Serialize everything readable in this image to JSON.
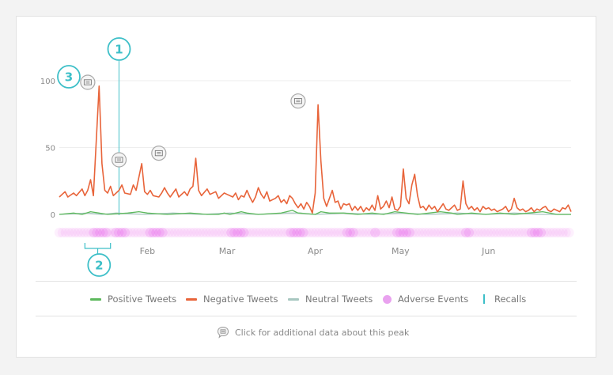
{
  "colors": {
    "positive": "#5cb85c",
    "negative": "#e8643a",
    "neutral": "#a7c7c0",
    "adverse": "#e23be6",
    "recall": "#3dbfc8",
    "grid": "#eeeeee",
    "axis_text": "#8a8a8a"
  },
  "chart_data": {
    "type": "line",
    "xlabel": "",
    "ylabel": "",
    "x_range": [
      0,
      180
    ],
    "ylim": [
      0,
      100
    ],
    "yticks": [
      0,
      50,
      100
    ],
    "x_ticks": [
      {
        "label": "Feb",
        "x": 31
      },
      {
        "label": "Mar",
        "x": 59
      },
      {
        "label": "Apr",
        "x": 90
      },
      {
        "label": "May",
        "x": 120
      },
      {
        "label": "Jun",
        "x": 151
      }
    ],
    "series": [
      {
        "name": "Negative Tweets",
        "color_key": "negative",
        "points": [
          [
            0,
            13
          ],
          [
            2,
            17
          ],
          [
            3,
            13
          ],
          [
            5,
            16
          ],
          [
            6,
            14
          ],
          [
            8,
            19
          ],
          [
            9,
            14
          ],
          [
            10,
            18
          ],
          [
            11,
            26
          ],
          [
            12,
            14
          ],
          [
            14,
            96
          ],
          [
            15,
            38
          ],
          [
            16,
            18
          ],
          [
            17,
            16
          ],
          [
            18,
            21
          ],
          [
            19,
            14
          ],
          [
            21,
            18
          ],
          [
            22,
            22
          ],
          [
            23,
            16
          ],
          [
            25,
            15
          ],
          [
            26,
            22
          ],
          [
            27,
            18
          ],
          [
            29,
            38
          ],
          [
            30,
            17
          ],
          [
            31,
            15
          ],
          [
            32,
            18
          ],
          [
            33,
            14
          ],
          [
            35,
            13
          ],
          [
            36,
            16
          ],
          [
            37,
            20
          ],
          [
            38,
            16
          ],
          [
            39,
            13
          ],
          [
            41,
            19
          ],
          [
            42,
            13
          ],
          [
            44,
            17
          ],
          [
            45,
            14
          ],
          [
            46,
            19
          ],
          [
            47,
            21
          ],
          [
            48,
            42
          ],
          [
            49,
            18
          ],
          [
            50,
            14
          ],
          [
            52,
            19
          ],
          [
            53,
            15
          ],
          [
            55,
            17
          ],
          [
            56,
            12
          ],
          [
            58,
            16
          ],
          [
            59,
            15
          ],
          [
            61,
            13
          ],
          [
            62,
            16
          ],
          [
            63,
            11
          ],
          [
            64,
            14
          ],
          [
            65,
            13
          ],
          [
            66,
            18
          ],
          [
            67,
            13
          ],
          [
            68,
            9
          ],
          [
            69,
            13
          ],
          [
            70,
            20
          ],
          [
            71,
            15
          ],
          [
            72,
            12
          ],
          [
            73,
            17
          ],
          [
            74,
            10
          ],
          [
            76,
            12
          ],
          [
            77,
            14
          ],
          [
            78,
            9
          ],
          [
            79,
            11
          ],
          [
            80,
            8
          ],
          [
            81,
            14
          ],
          [
            82,
            12
          ],
          [
            83,
            8
          ],
          [
            84,
            5
          ],
          [
            85,
            8
          ],
          [
            86,
            4
          ],
          [
            87,
            9
          ],
          [
            88,
            6
          ],
          [
            89,
            1
          ],
          [
            90,
            16
          ],
          [
            91,
            82
          ],
          [
            92,
            40
          ],
          [
            93,
            12
          ],
          [
            94,
            6
          ],
          [
            95,
            12
          ],
          [
            96,
            18
          ],
          [
            97,
            9
          ],
          [
            98,
            10
          ],
          [
            99,
            4
          ],
          [
            100,
            8
          ],
          [
            101,
            7
          ],
          [
            102,
            8
          ],
          [
            103,
            3
          ],
          [
            104,
            6
          ],
          [
            105,
            3
          ],
          [
            106,
            6
          ],
          [
            107,
            2
          ],
          [
            108,
            5
          ],
          [
            109,
            3
          ],
          [
            110,
            7
          ],
          [
            111,
            3
          ],
          [
            112,
            14
          ],
          [
            113,
            4
          ],
          [
            114,
            6
          ],
          [
            115,
            10
          ],
          [
            116,
            5
          ],
          [
            117,
            13
          ],
          [
            118,
            4
          ],
          [
            119,
            3
          ],
          [
            120,
            6
          ],
          [
            121,
            34
          ],
          [
            122,
            12
          ],
          [
            123,
            8
          ],
          [
            124,
            22
          ],
          [
            125,
            30
          ],
          [
            126,
            14
          ],
          [
            127,
            5
          ],
          [
            128,
            6
          ],
          [
            129,
            3
          ],
          [
            130,
            7
          ],
          [
            131,
            4
          ],
          [
            132,
            6
          ],
          [
            133,
            2
          ],
          [
            134,
            5
          ],
          [
            135,
            8
          ],
          [
            136,
            4
          ],
          [
            137,
            3
          ],
          [
            138,
            5
          ],
          [
            139,
            7
          ],
          [
            140,
            3
          ],
          [
            141,
            4
          ],
          [
            142,
            25
          ],
          [
            143,
            8
          ],
          [
            144,
            4
          ],
          [
            145,
            6
          ],
          [
            146,
            3
          ],
          [
            147,
            5
          ],
          [
            148,
            2
          ],
          [
            149,
            6
          ],
          [
            150,
            4
          ],
          [
            151,
            5
          ],
          [
            152,
            3
          ],
          [
            153,
            4
          ],
          [
            154,
            2
          ],
          [
            155,
            3
          ],
          [
            156,
            4
          ],
          [
            157,
            6
          ],
          [
            158,
            2
          ],
          [
            159,
            4
          ],
          [
            160,
            12
          ],
          [
            161,
            5
          ],
          [
            162,
            3
          ],
          [
            163,
            4
          ],
          [
            164,
            2
          ],
          [
            165,
            3
          ],
          [
            166,
            5
          ],
          [
            167,
            2
          ],
          [
            168,
            4
          ],
          [
            169,
            3
          ],
          [
            170,
            5
          ],
          [
            171,
            6
          ],
          [
            172,
            3
          ],
          [
            173,
            2
          ],
          [
            174,
            4
          ],
          [
            175,
            3
          ],
          [
            176,
            2
          ],
          [
            177,
            5
          ],
          [
            178,
            4
          ],
          [
            179,
            7
          ],
          [
            180,
            2
          ]
        ]
      },
      {
        "name": "Positive Tweets",
        "color_key": "positive",
        "points": [
          [
            0,
            0
          ],
          [
            5,
            1
          ],
          [
            8,
            0
          ],
          [
            11,
            2
          ],
          [
            14,
            1
          ],
          [
            17,
            0
          ],
          [
            24,
            1
          ],
          [
            28,
            2
          ],
          [
            31,
            1
          ],
          [
            38,
            0
          ],
          [
            46,
            1
          ],
          [
            52,
            0
          ],
          [
            56,
            0
          ],
          [
            58,
            1
          ],
          [
            60,
            0
          ],
          [
            64,
            2
          ],
          [
            66,
            1
          ],
          [
            70,
            0
          ],
          [
            78,
            1
          ],
          [
            82,
            3
          ],
          [
            84,
            1
          ],
          [
            90,
            0
          ],
          [
            92,
            2
          ],
          [
            95,
            1
          ],
          [
            100,
            1
          ],
          [
            105,
            0
          ],
          [
            110,
            1
          ],
          [
            114,
            0
          ],
          [
            118,
            2
          ],
          [
            122,
            1
          ],
          [
            126,
            0
          ],
          [
            130,
            1
          ],
          [
            134,
            2
          ],
          [
            138,
            1
          ],
          [
            140,
            0
          ],
          [
            145,
            1
          ],
          [
            150,
            0
          ],
          [
            155,
            1
          ],
          [
            160,
            0
          ],
          [
            165,
            1
          ],
          [
            170,
            2
          ],
          [
            175,
            0
          ],
          [
            180,
            0
          ]
        ]
      },
      {
        "name": "Neutral Tweets",
        "color_key": "neutral",
        "points": [
          [
            0,
            0
          ],
          [
            10,
            1
          ],
          [
            15,
            0
          ],
          [
            20,
            1
          ],
          [
            30,
            0
          ],
          [
            40,
            1
          ],
          [
            50,
            0
          ],
          [
            60,
            1
          ],
          [
            70,
            0
          ],
          [
            80,
            1
          ],
          [
            85,
            1
          ],
          [
            90,
            0
          ],
          [
            100,
            1
          ],
          [
            110,
            0
          ],
          [
            120,
            1
          ],
          [
            130,
            0
          ],
          [
            140,
            1
          ],
          [
            150,
            0
          ],
          [
            160,
            1
          ],
          [
            170,
            0
          ],
          [
            180,
            0
          ]
        ]
      }
    ],
    "recall_x": 21,
    "adverse_events": {
      "start": 0,
      "end": 180,
      "dense_ranges": [
        [
          11,
          17
        ],
        [
          19,
          24
        ],
        [
          31,
          37
        ],
        [
          60,
          66
        ],
        [
          81,
          86
        ],
        [
          101,
          104
        ],
        [
          110,
          112
        ],
        [
          118,
          124
        ],
        [
          142,
          145
        ],
        [
          166,
          170
        ]
      ]
    },
    "peak_markers": [
      {
        "x": 10,
        "y": 100
      },
      {
        "x": 21,
        "y": 42
      },
      {
        "x": 35,
        "y": 47
      },
      {
        "x": 84,
        "y": 86
      }
    ],
    "callouts": [
      {
        "label": "1",
        "target": "recall"
      },
      {
        "label": "2",
        "target": "adverse-range"
      },
      {
        "label": "3",
        "target": "y-max"
      }
    ]
  },
  "legend": {
    "positive": "Positive Tweets",
    "negative": "Negative Tweets",
    "neutral": "Neutral Tweets",
    "adverse": "Adverse Events",
    "recalls": "Recalls"
  },
  "note": "Click for additional data about this peak"
}
